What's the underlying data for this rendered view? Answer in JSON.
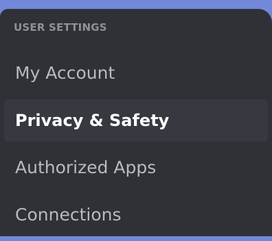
{
  "settings_menu": {
    "section_header": "USER SETTINGS",
    "items": [
      {
        "label": "My Account"
      },
      {
        "label": "Privacy & Safety"
      },
      {
        "label": "Authorized Apps"
      },
      {
        "label": "Connections"
      }
    ]
  },
  "colors": {
    "backdrop": "#7289da",
    "panel_background": "#2f3136",
    "selected_item_background": "#36393f",
    "header_text": "#8e9297",
    "item_text": "#b9bbbe",
    "selected_item_text": "#ffffff"
  }
}
